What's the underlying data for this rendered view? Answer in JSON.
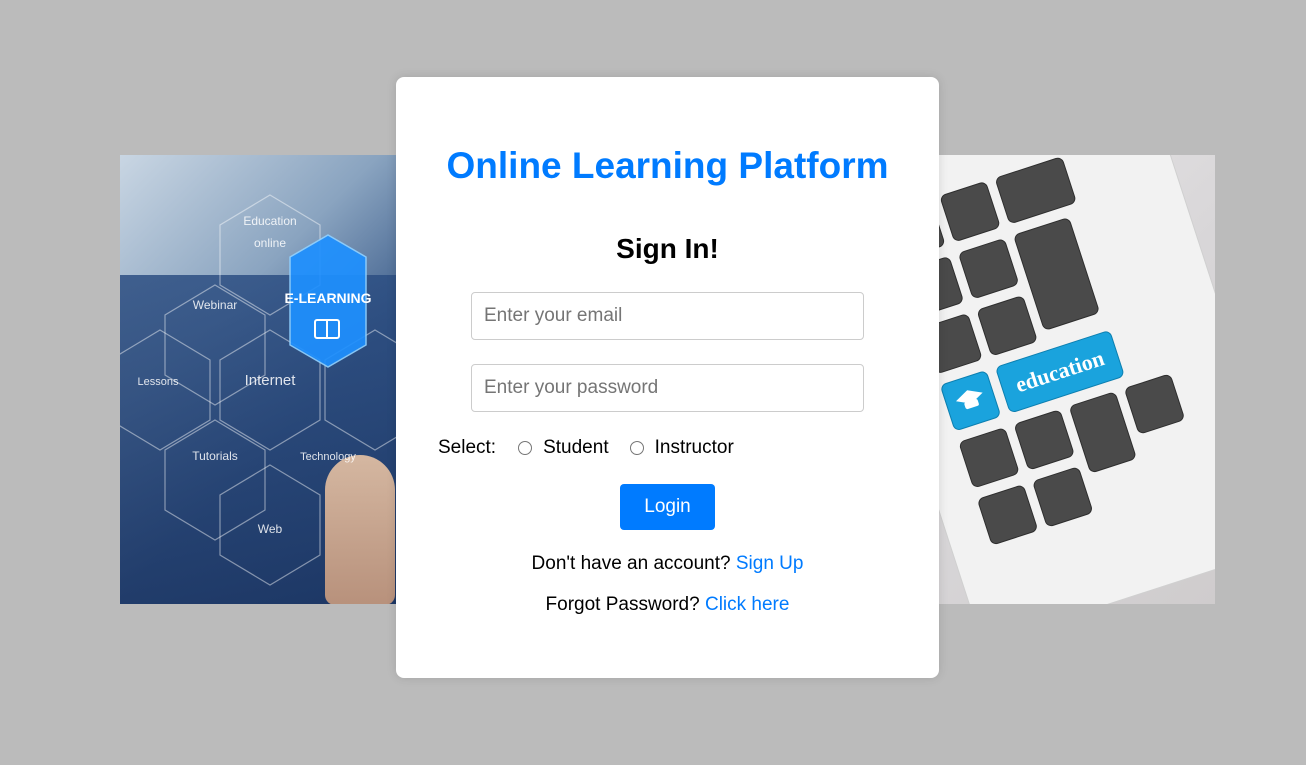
{
  "app": {
    "title": "Online Learning Platform"
  },
  "form": {
    "heading": "Sign In!",
    "email": {
      "value": "",
      "placeholder": "Enter your email"
    },
    "password": {
      "value": "",
      "placeholder": "Enter your password"
    },
    "role_label": "Select:",
    "roles": [
      {
        "label": "Student",
        "selected": false
      },
      {
        "label": "Instructor",
        "selected": false
      }
    ],
    "login_label": "Login"
  },
  "links": {
    "signup_prompt": "Don't have an account?",
    "signup_link": "Sign Up",
    "forgot_prompt": "Forgot Password?",
    "forgot_link": "Click here"
  },
  "images": {
    "left": {
      "labels": [
        "Education",
        "online",
        "Webinar",
        "E-LEARNING",
        "Lessons",
        "Internet",
        "Tutorials",
        "Technology",
        "Web"
      ]
    },
    "right": {
      "key_label": "education"
    }
  },
  "colors": {
    "accent": "#007bff",
    "background": "#bbbbbb",
    "card": "#ffffff"
  }
}
